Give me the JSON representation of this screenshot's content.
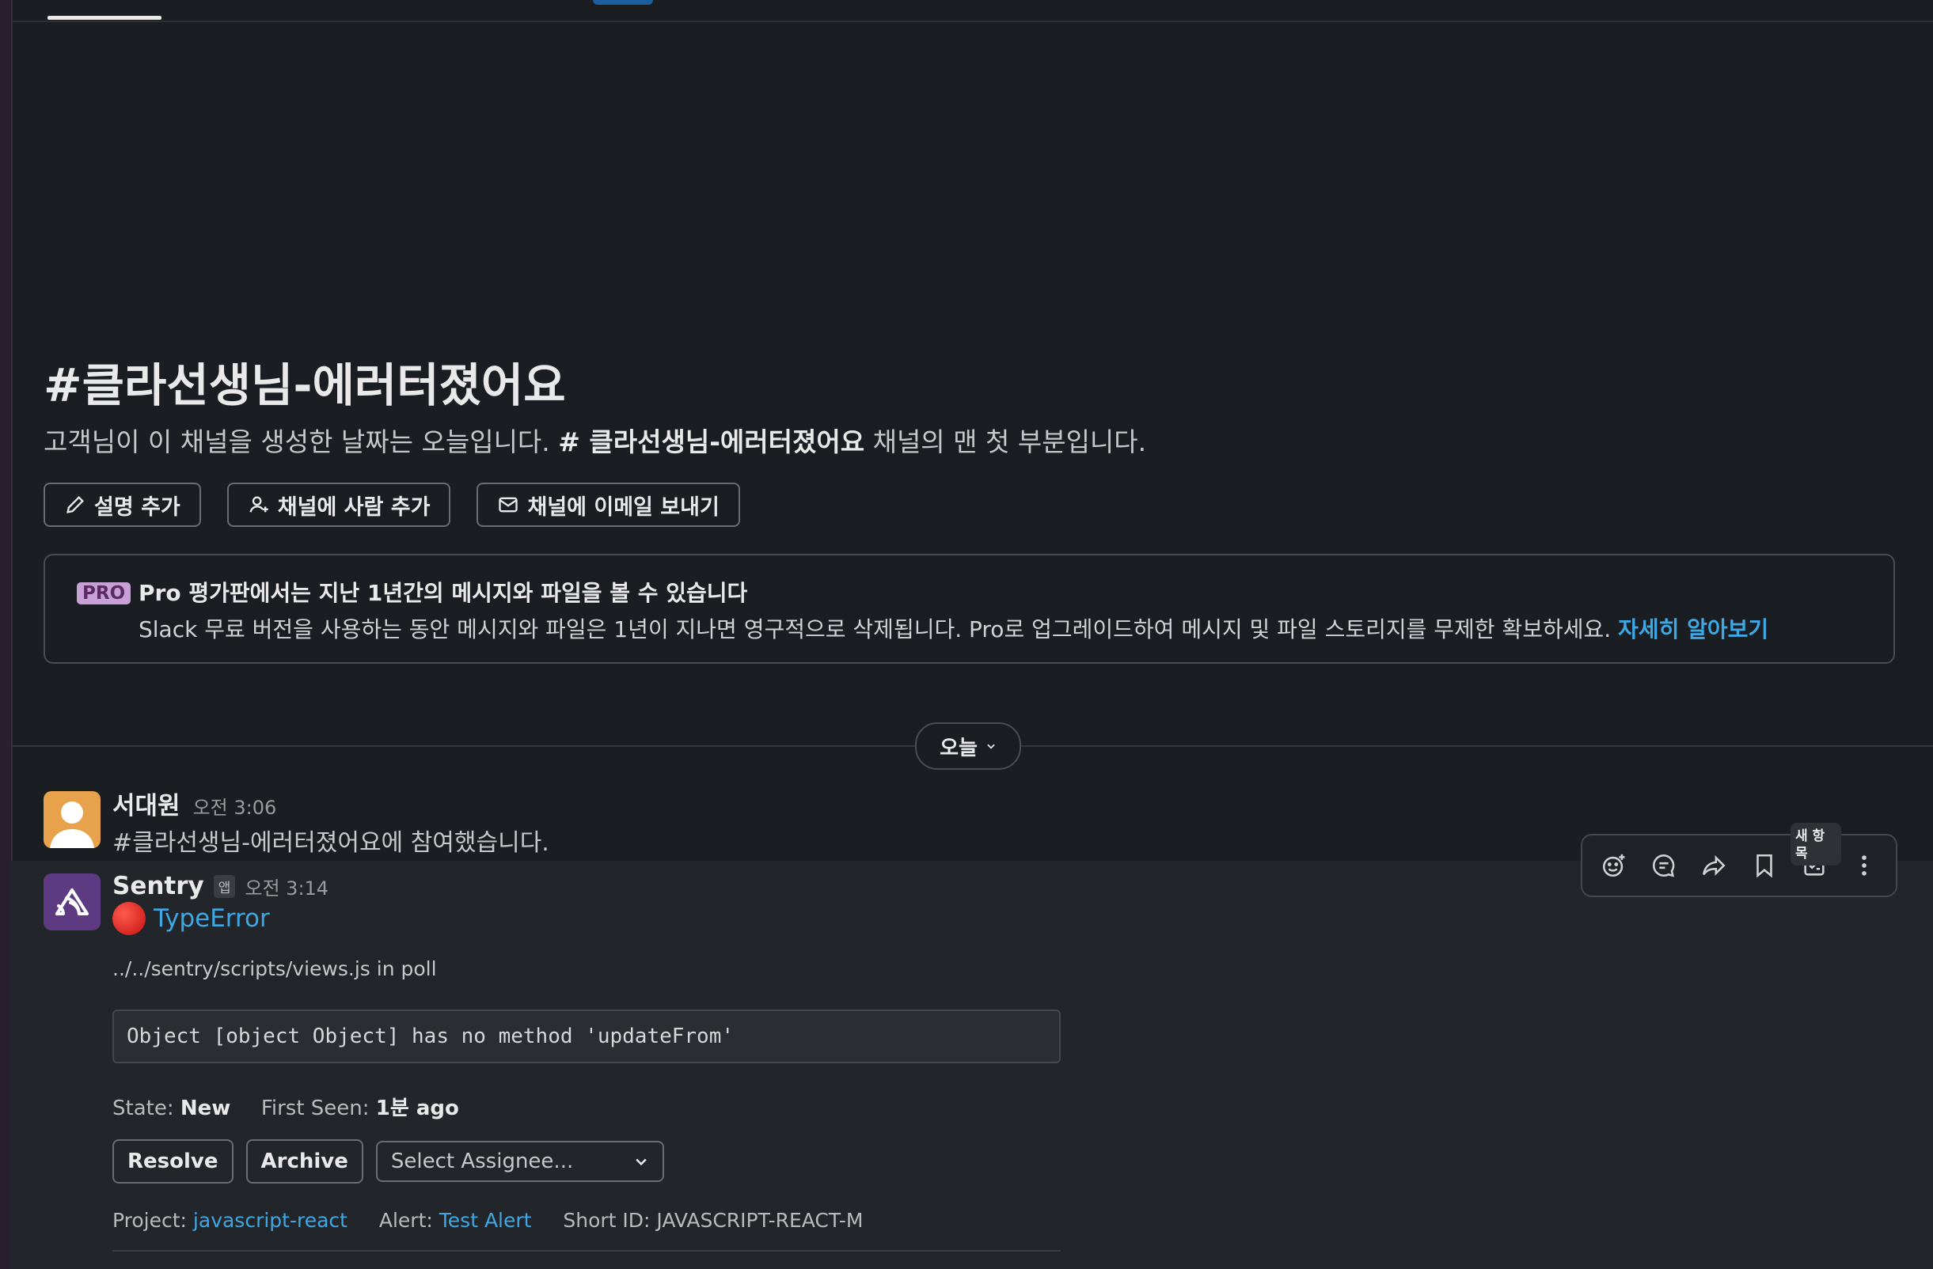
{
  "channel": {
    "title": "#클라선생님-에러터졌어요",
    "description_before": "고객님이 이 채널을 생성한 날짜는 오늘입니다.",
    "description_channel": "# 클라선생님-에러터졌어요",
    "description_after": "채널의 맨 첫 부분입니다."
  },
  "actions": {
    "add_description": "설명 추가",
    "add_people": "채널에 사람 추가",
    "send_email": "채널에 이메일 보내기"
  },
  "pro_banner": {
    "badge": "PRO",
    "title": "Pro 평가판에서는 지난 1년간의 메시지와 파일을 볼 수 있습니다",
    "body": "Slack 무료 버전을 사용하는 동안 메시지와 파일은 1년이 지나면 영구적으로 삭제됩니다. Pro로 업그레이드하여 메시지 및 파일 스토리지를 무제한 확보하세요.",
    "link": "자세히 알아보기"
  },
  "date_divider": {
    "label": "오늘"
  },
  "messages": [
    {
      "author": "서대원",
      "time": "오전 3:06",
      "text": "#클라선생님-에러터졌어요에 참여했습니다."
    },
    {
      "author": "Sentry",
      "app_badge": "앱",
      "time": "오전 3:14",
      "error_title": "TypeError",
      "path": "../../sentry/scripts/views.js in poll",
      "code": "Object [object Object] has no method 'updateFrom'",
      "state_label": "State:",
      "state_value": "New",
      "first_seen_label": "First Seen:",
      "first_seen_value": "1분 ago",
      "resolve": "Resolve",
      "archive": "Archive",
      "assignee_placeholder": "Select Assignee...",
      "project_label": "Project:",
      "project_value": "javascript-react",
      "alert_label": "Alert:",
      "alert_value": "Test Alert",
      "short_id_label": "Short ID:",
      "short_id_value": "JAVASCRIPT-REACT-M"
    }
  ],
  "hover_toolbar": {
    "icons": [
      "add-reaction-icon",
      "reply-thread-icon",
      "share-icon",
      "bookmark-icon",
      "save-later-icon",
      "more-actions-icon"
    ],
    "tooltip": "새 항목"
  },
  "colors": {
    "link": "#3ea8e5",
    "pro_badge": "#c7a0d6",
    "background": "#1a1d21"
  }
}
